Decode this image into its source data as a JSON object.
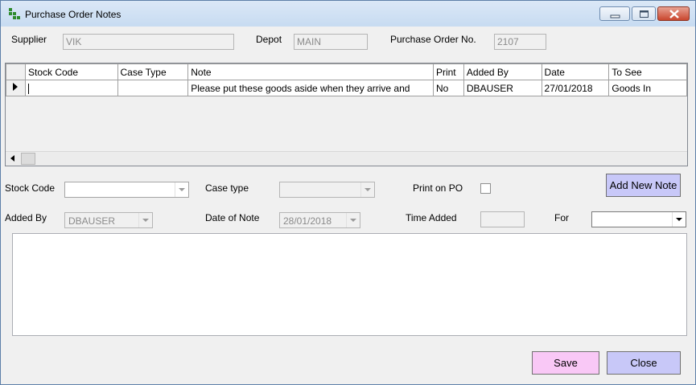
{
  "window": {
    "title": "Purchase Order Notes"
  },
  "header": {
    "supplier_label": "Supplier",
    "supplier_value": "VIK",
    "depot_label": "Depot",
    "depot_value": "MAIN",
    "po_label": "Purchase Order No.",
    "po_value": "2107"
  },
  "grid": {
    "columns": [
      "Stock Code",
      "Case Type",
      "Note",
      "Print",
      "Added By",
      "Date",
      "To See"
    ],
    "rows": [
      [
        "",
        "",
        "Please put these goods aside when they arrive and",
        "No",
        "DBAUSER",
        "27/01/2018",
        "Goods In"
      ]
    ]
  },
  "form": {
    "stock_code_label": "Stock Code",
    "stock_code_value": "",
    "case_type_label": "Case type",
    "case_type_value": "",
    "print_on_po_label": "Print on PO",
    "print_on_po_checked": false,
    "added_by_label": "Added By",
    "added_by_value": "DBAUSER",
    "date_label": "Date of Note",
    "date_value": "28/01/2018",
    "time_label": "Time Added",
    "time_value": "",
    "for_label": "For",
    "for_value": "",
    "notes_value": ""
  },
  "buttons": {
    "add_new_note": "Add New Note",
    "save": "Save",
    "close": "Close"
  },
  "colors": {
    "add_button": "#c8c8f8",
    "save_button": "#f9c8f6",
    "close_button": "#c8c8f8"
  },
  "icons": {
    "title": "app-grid-icon",
    "row_pointer": "row-pointer-icon"
  }
}
